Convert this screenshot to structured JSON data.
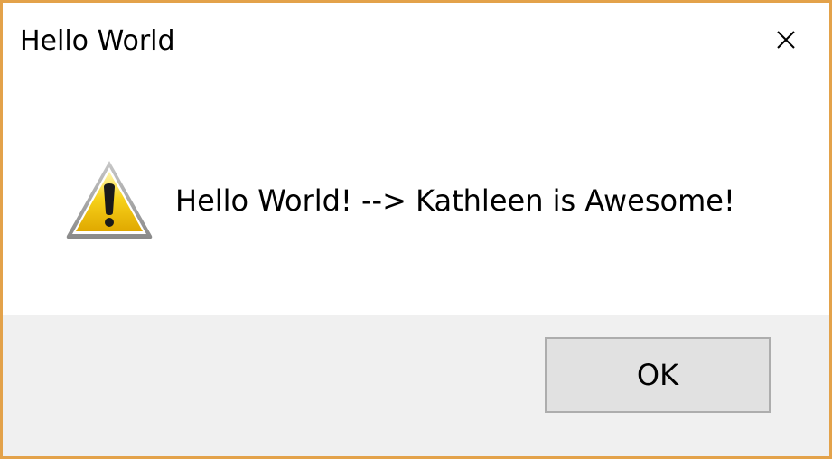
{
  "window": {
    "title": "Hello World",
    "close_icon": "close-icon",
    "border_color": "#e3a24a"
  },
  "content": {
    "icon": "warning-icon",
    "message": "Hello World! --> Kathleen is Awesome!"
  },
  "footer": {
    "ok_label": "OK",
    "background": "#f0f0f0"
  }
}
